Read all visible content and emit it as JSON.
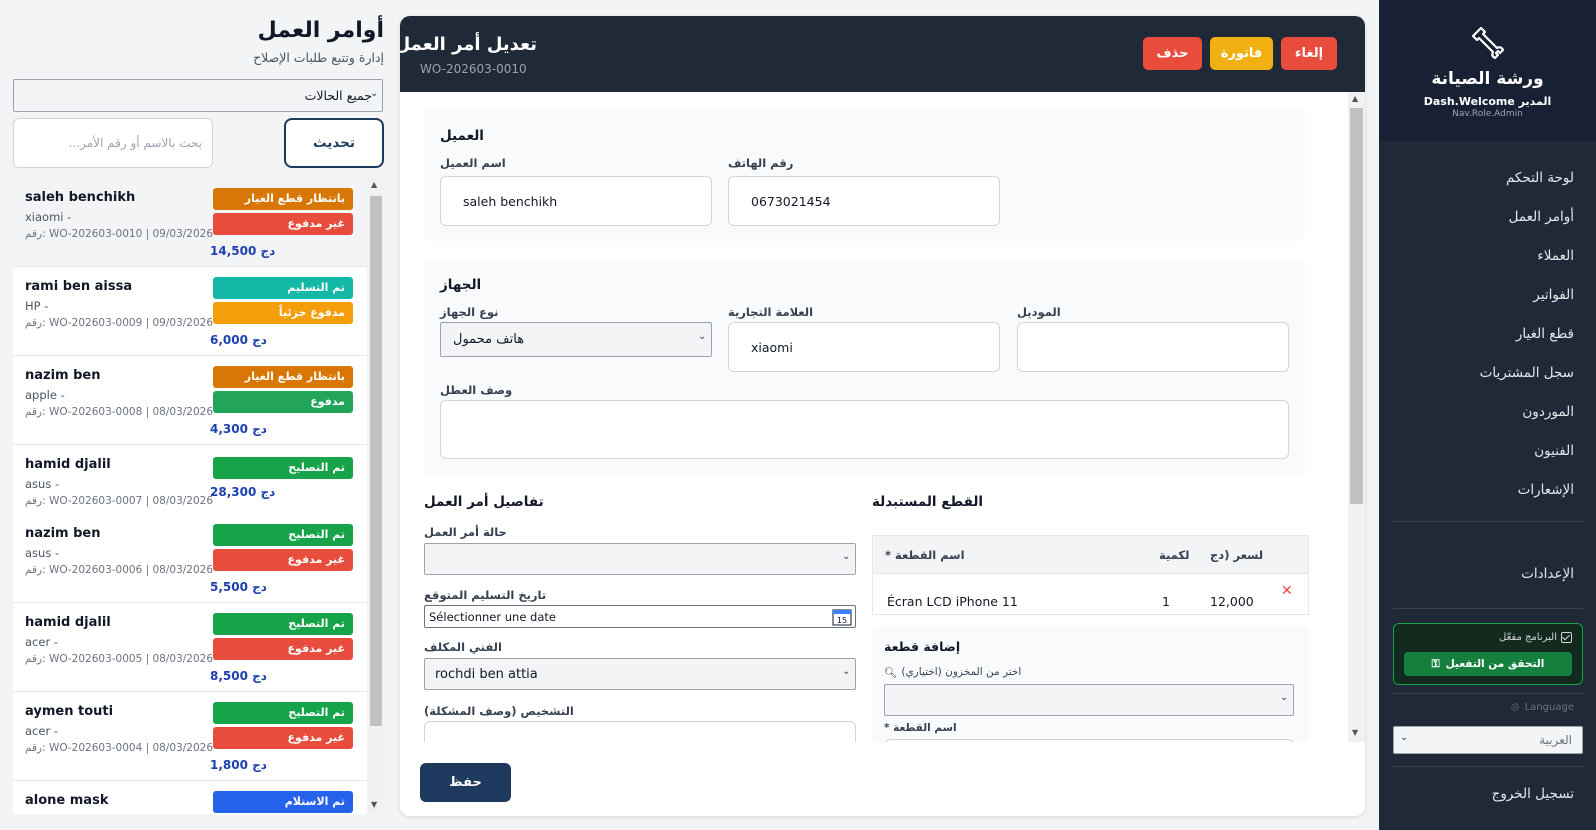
{
  "sidebar": {
    "title": "ورشة الصيانة",
    "user": "Dash.Welcome المدير",
    "role": "Nav.Role.Admin",
    "nav": [
      {
        "label": "لوحة التحكم"
      },
      {
        "label": "أوامر العمل"
      },
      {
        "label": "العملاء"
      },
      {
        "label": "الفواتير"
      },
      {
        "label": "قطع الغيار"
      },
      {
        "label": "سجل المشتريات"
      },
      {
        "label": "الموردون"
      },
      {
        "label": "الفنيون"
      },
      {
        "label": "الإشعارات"
      }
    ],
    "settings": "الإعدادات",
    "activation": {
      "status": "البرنامج مفعّل",
      "button": "التحقق من التفعيل"
    },
    "language_label": "Language",
    "language_value": "العربية",
    "logout": "تسجيل الخروج"
  },
  "list_panel": {
    "title": "أوامر العمل",
    "subtitle": "إدارة وتتبع طلبات الإصلاح",
    "status_filter": "جميع الحالات",
    "search_placeholder": "...بحث بالاسم أو رقم الأمر",
    "refresh": "تحديث",
    "orders": [
      {
        "name": "saleh benchikh",
        "brand": "xiaomi  -",
        "meta": "رقم: WO-202603-0010   |   09/03/2026",
        "amount": "دج 14,500",
        "badges": [
          {
            "label": "بانتظار قطع الغيار",
            "color": "#d97706"
          },
          {
            "label": "غير مدفوع",
            "color": "#e74c3c"
          }
        ]
      },
      {
        "name": "rami ben aissa",
        "brand": "HP  -",
        "meta": "رقم: WO-202603-0009   |   09/03/2026",
        "amount": "دج 6,000",
        "badges": [
          {
            "label": "تم التسليم",
            "color": "#14b8a6"
          },
          {
            "label": "مدفوع جزئياً",
            "color": "#f59e0b"
          }
        ]
      },
      {
        "name": "nazim ben",
        "brand": "apple  -",
        "meta": "رقم: WO-202603-0008   |   08/03/2026",
        "amount": "دج 4,300",
        "badges": [
          {
            "label": "بانتظار قطع الغيار",
            "color": "#d97706"
          },
          {
            "label": "مدفوع",
            "color": "#22a55b"
          }
        ]
      },
      {
        "name": "hamid djalil",
        "brand": "asus  -",
        "meta": "رقم: WO-202603-0007   |   08/03/2026",
        "amount": "دج 28,300",
        "badges": [
          {
            "label": "تم التصليح",
            "color": "#16a34a"
          }
        ]
      },
      {
        "name": "nazim ben",
        "brand": "asus  -",
        "meta": "رقم: WO-202603-0006   |   08/03/2026",
        "amount": "دج 5,500",
        "badges": [
          {
            "label": "تم التصليح",
            "color": "#16a34a"
          },
          {
            "label": "غير مدفوع",
            "color": "#e74c3c"
          }
        ]
      },
      {
        "name": "hamid djalil",
        "brand": "acer  -",
        "meta": "رقم: WO-202603-0005   |   08/03/2026",
        "amount": "دج 8,500",
        "badges": [
          {
            "label": "تم التصليح",
            "color": "#16a34a"
          },
          {
            "label": "غير مدفوع",
            "color": "#e74c3c"
          }
        ]
      },
      {
        "name": "aymen touti",
        "brand": "acer  -",
        "meta": "رقم: WO-202603-0004   |   08/03/2026",
        "amount": "دج 1,800",
        "badges": [
          {
            "label": "تم التصليح",
            "color": "#16a34a"
          },
          {
            "label": "غير مدفوع",
            "color": "#e74c3c"
          }
        ]
      },
      {
        "name": "alone mask",
        "brand": "",
        "meta": "",
        "amount": "",
        "badges": [
          {
            "label": "تم الاستلام",
            "color": "#2563eb"
          }
        ]
      }
    ]
  },
  "editor": {
    "title": "تعديل أمر العمل",
    "code": "WO-202603-0010",
    "buttons": {
      "cancel": "إلغاء",
      "invoice": "فاتورة",
      "delete": "حذف",
      "save": "حفظ"
    },
    "customer": {
      "section": "العميل",
      "name_label": "اسم العميل",
      "name_value": "saleh benchikh",
      "phone_label": "رقم الهاتف",
      "phone_value": "0673021454"
    },
    "device": {
      "section": "الجهاز",
      "type_label": "نوع الجهاز",
      "type_value": "هاتف محمول",
      "brand_label": "العلامة التجارية",
      "brand_value": "xiaomi",
      "model_label": "الموديل",
      "model_value": "",
      "fault_label": "وصف العطل",
      "fault_value": ""
    },
    "details": {
      "section": "تفاصيل أمر العمل",
      "status_label": "حالة أمر العمل",
      "status_value": "",
      "date_label": "تاريخ التسليم المتوقع",
      "date_placeholder": "Sélectionner une date",
      "tech_label": "الفني المكلف",
      "tech_value": "rochdi ben attia",
      "diag_label": "(التشخيص (وصف المشكلة"
    },
    "parts": {
      "section": "القطع المستبدلة",
      "headers": {
        "name": "* اسم القطعة",
        "qty": "لكمية",
        "price": "لسعر (دج"
      },
      "rows": [
        {
          "name": "Écran LCD iPhone 11",
          "qty": "1",
          "price": "12,000"
        }
      ],
      "add_title": "إضافة قطعة",
      "stock_label": "(اختر من المخزون (اختياري",
      "part_name_label": "* اسم القطعة"
    }
  }
}
